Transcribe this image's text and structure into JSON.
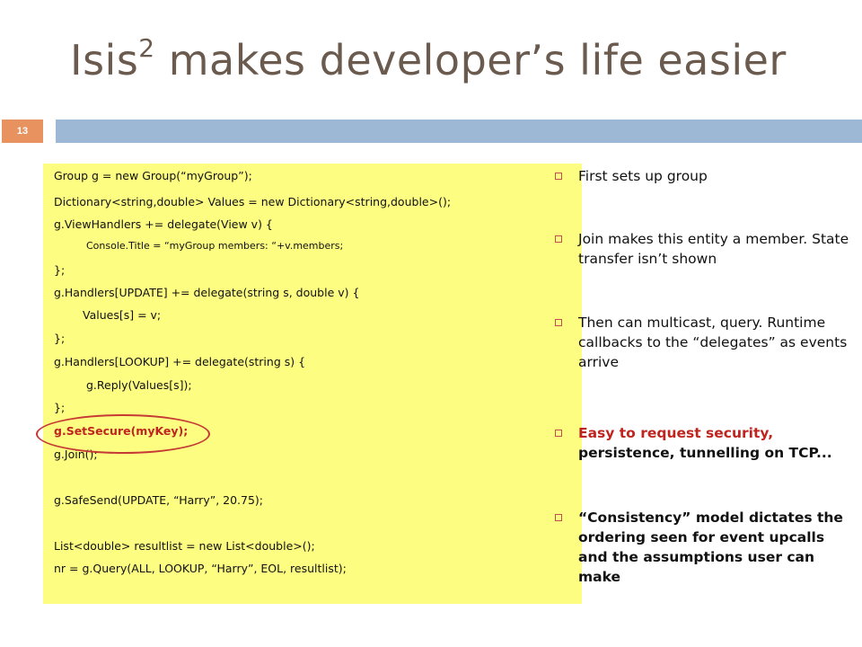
{
  "slide": {
    "title": "Isis",
    "title_sup": "2",
    "title_rest": " makes developer’s life easier",
    "slide_number": "13"
  },
  "code": [
    "Group g = new Group(“myGroup”);",
    "Dictionary<string,double> Values = new Dictionary<string,double>();",
    "g.ViewHandlers += delegate(View v) {",
    "Console.Title = “myGroup members: “+v.members;",
    "};",
    "g.Handlers[UPDATE]  += delegate(string s, double v) {",
    "Values[s] = v;",
    "};",
    "g.Handlers[LOOKUP] += delegate(string s) {",
    "g.Reply(Values[s]);",
    "};",
    "g.SetSecure(myKey);",
    "g.Join();",
    "g.SafeSend(UPDATE, “Harry”, 20.75);",
    "List<double> resultlist = new List<double>();",
    "nr = g.Query(ALL, LOOKUP, “Harry”, EOL, resultlist);"
  ],
  "bullets": [
    "First sets up group",
    "Join makes this entity a member. State transfer isn’t shown",
    "Then can multicast, query.  Runtime callbacks to the “delegates” as events arrive",
    {
      "red": "Easy to request security,",
      "rest": " persistence, tunnelling on TCP..."
    },
    "“Consistency” model dictates the ordering seen for event upcalls and the assumptions user can make"
  ],
  "colors": {
    "title": "#6b5a4e",
    "number_box": "#e8925f",
    "title_bar": "#9db8d5",
    "code_bg": "#fdfd82",
    "highlight": "#c0241e"
  },
  "icons": {
    "bullet": "hollow-square-bullet-icon"
  }
}
